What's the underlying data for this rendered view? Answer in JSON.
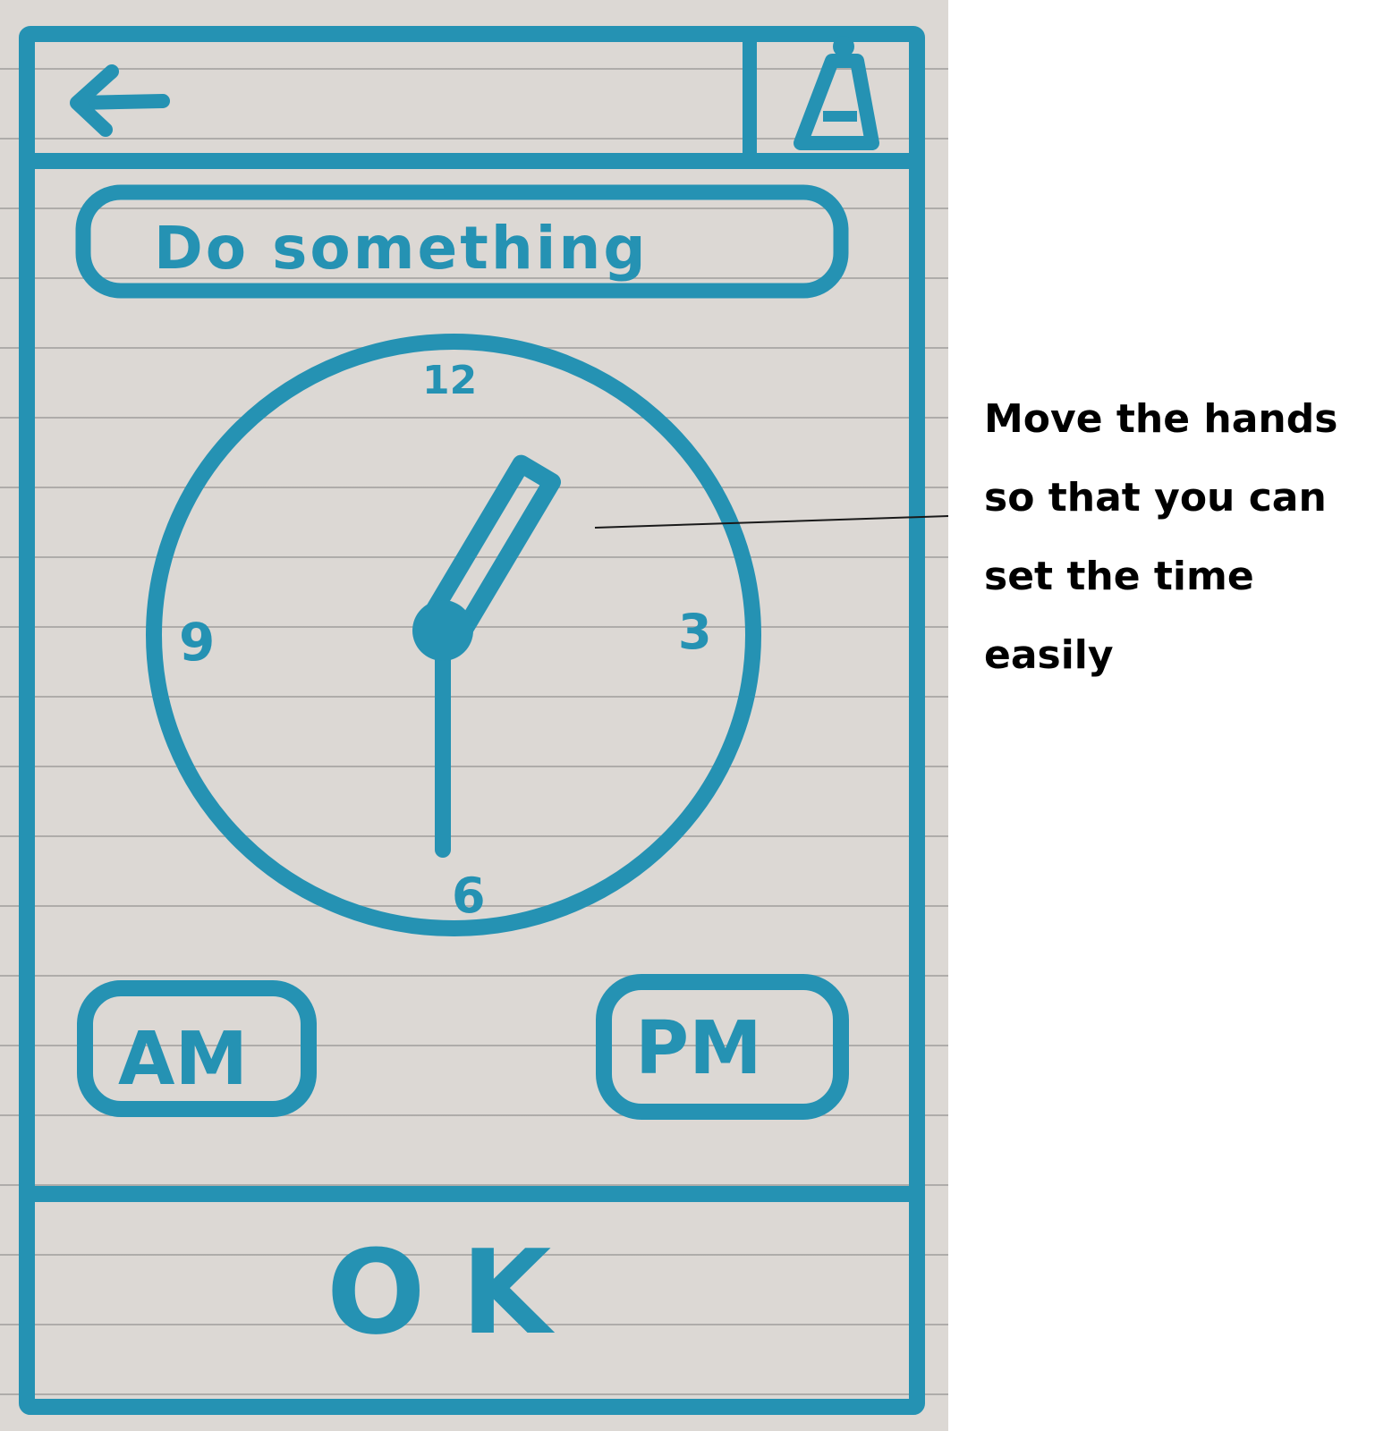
{
  "header": {
    "back_icon": "left-arrow-icon",
    "bell_icon": "bell-icon"
  },
  "task_input": {
    "value": "Do something"
  },
  "clock": {
    "numerals": {
      "n12": "12",
      "n3": "3",
      "n6": "6",
      "n9": "9"
    },
    "hour": 1,
    "minute": 30
  },
  "buttons": {
    "am_label": "AM",
    "pm_label": "PM",
    "ok_label": "OK"
  },
  "annotation": {
    "lines": [
      "Move the hands",
      "so that you can",
      "set the time",
      "easily"
    ]
  },
  "colors": {
    "ink": "#2592b3",
    "paper": "#dcd8d4"
  }
}
